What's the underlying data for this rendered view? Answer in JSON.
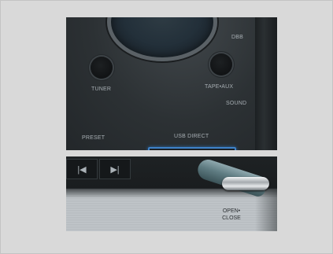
{
  "labels": {
    "dbb": "DBB",
    "tuner": "TUNER",
    "tape_aux": "TAPE•AUX",
    "sound": "SOUND",
    "preset": "PRESET",
    "usb_direct": "USB DIRECT",
    "open_close_line1": "OPEN•",
    "open_close_line2": "CLOSE"
  },
  "buttons": {
    "prev_glyph": "|◀",
    "next_glyph": "▶|"
  },
  "colors": {
    "usb_slot_border": "#3e82c9",
    "background": "#d9d9d9"
  }
}
